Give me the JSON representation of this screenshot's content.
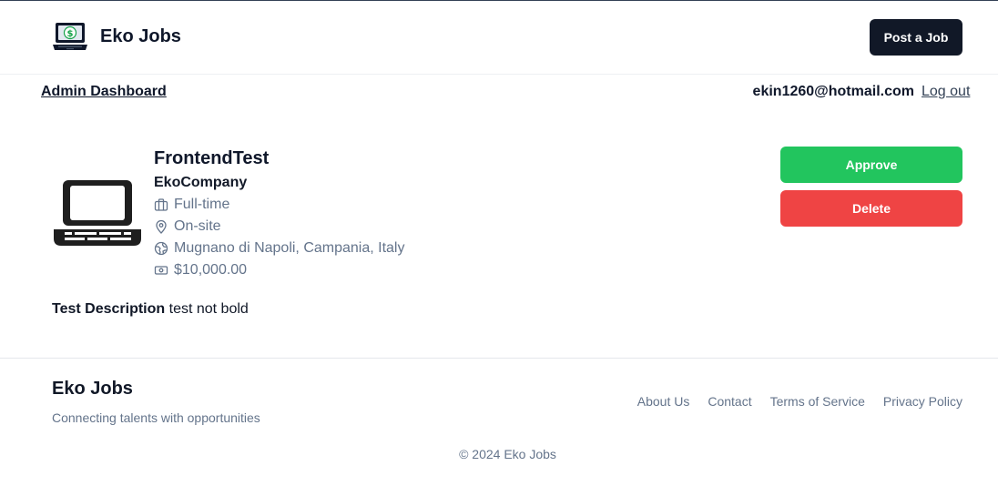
{
  "header": {
    "brand_name": "Eko Jobs",
    "post_job_label": "Post a Job"
  },
  "subnav": {
    "admin_link": "Admin Dashboard",
    "user_email": "ekin1260@hotmail.com",
    "logout_label": "Log out"
  },
  "job": {
    "title": "FrontendTest",
    "company": "EkoCompany",
    "employment_type": "Full-time",
    "work_mode": "On-site",
    "location": "Mugnano di Napoli, Campania, Italy",
    "salary": "$10,000.00",
    "description_label": "Test Description",
    "description_text": "test not bold",
    "icons": {
      "type": "briefcase-icon",
      "mode": "map-pin-icon",
      "location": "globe-icon",
      "salary": "banknote-icon"
    }
  },
  "actions": {
    "approve_label": "Approve",
    "delete_label": "Delete"
  },
  "footer": {
    "brand_name": "Eko Jobs",
    "tagline": "Connecting talents with opportunities",
    "links": [
      "About Us",
      "Contact",
      "Terms of Service",
      "Privacy Policy"
    ],
    "copyright": "© 2024 Eko Jobs"
  },
  "colors": {
    "primary_dark": "#111827",
    "approve": "#22c55e",
    "delete": "#ef4444",
    "muted_text": "#64748b"
  }
}
